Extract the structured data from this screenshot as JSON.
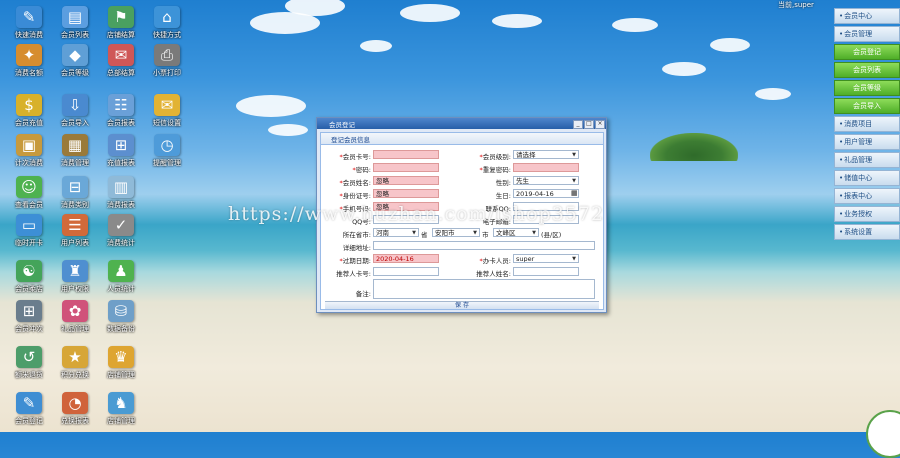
{
  "top_info": "当前,super",
  "desktop_icons": [
    {
      "label": "快速消费",
      "color": "#3a8bd6",
      "glyph": "✎"
    },
    {
      "label": "会员列表",
      "color": "#5b9ee0",
      "glyph": "▤"
    },
    {
      "label": "店铺结算",
      "color": "#4aa060",
      "glyph": "⚑"
    },
    {
      "label": "快捷方式",
      "color": "#3d93d8",
      "glyph": "⌂"
    },
    {
      "label": "消费名额",
      "color": "#d68d2f",
      "glyph": "✦"
    },
    {
      "label": "会员等级",
      "color": "#5f9fd6",
      "glyph": "◆"
    },
    {
      "label": "总部结算",
      "color": "#cf5757",
      "glyph": "✉"
    },
    {
      "label": "小票打印",
      "color": "#7a7a7a",
      "glyph": "⎙"
    },
    {
      "label": "会员充值",
      "color": "#d8b12a",
      "glyph": "$"
    },
    {
      "label": "会员导入",
      "color": "#4a8ad0",
      "glyph": "⇩"
    },
    {
      "label": "会员报表",
      "color": "#6aa0d8",
      "glyph": "☷"
    },
    {
      "label": "短信设置",
      "color": "#e2b334",
      "glyph": "✉"
    },
    {
      "label": "计次消费",
      "color": "#c79a3d",
      "glyph": "▣"
    },
    {
      "label": "消费管理",
      "color": "#9a7a3a",
      "glyph": "▦"
    },
    {
      "label": "充值报表",
      "color": "#5c8fcf",
      "glyph": "⊞"
    },
    {
      "label": "提醒管理",
      "color": "#4e9bd9",
      "glyph": "◷"
    },
    {
      "label": "查看会员",
      "color": "#4eb24f",
      "glyph": "☺"
    },
    {
      "label": "消费类别",
      "color": "#6aa8d8",
      "glyph": "⊟"
    },
    {
      "label": "消费报表",
      "color": "#8fbad8",
      "glyph": "▥"
    },
    {
      "label": "临时开卡",
      "color": "#3d8fd6",
      "glyph": "▭"
    },
    {
      "label": "用户列表",
      "color": "#d26a3a",
      "glyph": "☰"
    },
    {
      "label": "消费统计",
      "color": "#8a8a8a",
      "glyph": "✓"
    },
    {
      "label": "会员柔店",
      "color": "#44a45a",
      "glyph": "☯"
    },
    {
      "label": "用户权限",
      "color": "#4f8fd0",
      "glyph": "♜"
    },
    {
      "label": "人员统计",
      "color": "#4fb24f",
      "glyph": "♟"
    },
    {
      "label": "会员冲次",
      "color": "#6a7d8d",
      "glyph": "⊞"
    },
    {
      "label": "礼品管理",
      "color": "#d0527a",
      "glyph": "✿"
    },
    {
      "label": "数据备份",
      "color": "#6f9fc8",
      "glyph": "⛁"
    },
    {
      "label": "额米退货",
      "color": "#4d9d6a",
      "glyph": "↺"
    },
    {
      "label": "积分兑换",
      "color": "#d7a637",
      "glyph": "★"
    },
    {
      "label": "店铺管理",
      "color": "#dea531",
      "glyph": "♛"
    },
    {
      "label": "会员登记",
      "color": "#3f8ed3",
      "glyph": "✎"
    },
    {
      "label": "兑换报表",
      "color": "#d0633b",
      "glyph": "◔"
    },
    {
      "label": "店铺管理",
      "color": "#4a9bd3",
      "glyph": "♞"
    }
  ],
  "nav": [
    {
      "label": "会员中心",
      "style": "blue",
      "bullet": true
    },
    {
      "label": "会员管理",
      "style": "blue",
      "bullet": true
    },
    {
      "label": "会员登记",
      "style": "green",
      "bullet": false
    },
    {
      "label": "会员列表",
      "style": "green",
      "bullet": false
    },
    {
      "label": "会员等级",
      "style": "green",
      "bullet": false
    },
    {
      "label": "会员导入",
      "style": "green",
      "bullet": false
    },
    {
      "label": "消费项目",
      "style": "blue",
      "bullet": true
    },
    {
      "label": "用户管理",
      "style": "blue",
      "bullet": true
    },
    {
      "label": "礼品管理",
      "style": "blue",
      "bullet": true
    },
    {
      "label": "储值中心",
      "style": "blue",
      "bullet": true
    },
    {
      "label": "报表中心",
      "style": "blue",
      "bullet": true
    },
    {
      "label": "业务授权",
      "style": "blue",
      "bullet": true
    },
    {
      "label": "系统设置",
      "style": "blue",
      "bullet": true
    }
  ],
  "window": {
    "title": "会员登记",
    "panel_title": "登记会员信息",
    "save_label": "保 存",
    "fields": {
      "card_no": {
        "label": "会员卡号:",
        "value": "",
        "required": true
      },
      "password": {
        "label": "密码:",
        "value": "",
        "required": true
      },
      "name": {
        "label": "会员姓名:",
        "value": "忽略",
        "required": true
      },
      "id_no": {
        "label": "身份证号:",
        "value": "忽略",
        "required": true
      },
      "phone": {
        "label": "手机号码:",
        "value": "忽略",
        "required": true
      },
      "qq": {
        "label": "QQ号:",
        "value": ""
      },
      "province": {
        "label": "所在省市:",
        "value": "河南",
        "suffix": "省"
      },
      "city": {
        "value": "安阳市",
        "suffix": "市"
      },
      "district": {
        "value": "文峰区",
        "suffix": "(县/区)"
      },
      "address": {
        "label": "详细地址:",
        "value": ""
      },
      "expire": {
        "label": "过期日期:",
        "value": "2020-04-16",
        "required": true
      },
      "referrer_card": {
        "label": "推荐人卡号:",
        "value": ""
      },
      "remark": {
        "label": "备注:",
        "value": ""
      },
      "level": {
        "label": "会员级别:",
        "value": "请选择",
        "required": true
      },
      "confirm_pwd": {
        "label": "重复密码:",
        "value": "",
        "required": true
      },
      "gender": {
        "label": "性别:",
        "value": "先生"
      },
      "birthday": {
        "label": "生日:",
        "value": "2019-04-16"
      },
      "contact": {
        "label": "联系QQ:",
        "value": ""
      },
      "email": {
        "label": "电子邮箱:",
        "value": ""
      },
      "operator": {
        "label": "办卡人员:",
        "value": "super",
        "required": true
      },
      "referrer_name": {
        "label": "推荐人姓名:",
        "value": ""
      }
    }
  },
  "watermark": "https://www.huzhan.com/ishop3572"
}
